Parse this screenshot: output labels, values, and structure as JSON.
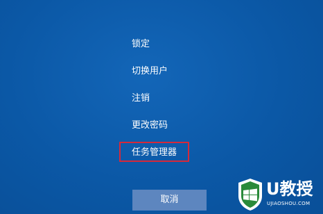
{
  "menu": {
    "items": [
      {
        "label": "锁定"
      },
      {
        "label": "切换用户"
      },
      {
        "label": "注销"
      },
      {
        "label": "更改密码"
      },
      {
        "label": "任务管理器"
      }
    ],
    "highlighted_item": "任务管理器",
    "highlight_color": "#d6293a"
  },
  "cancel": {
    "label": "取消"
  },
  "watermark": {
    "logo_text": "U教授",
    "url_text": "UJIAOSHOU.COM",
    "icon": "shield-windows-logo-icon"
  },
  "colors": {
    "background": "#0b5aa8",
    "button": "#5d86bf",
    "text": "#ffffff"
  }
}
